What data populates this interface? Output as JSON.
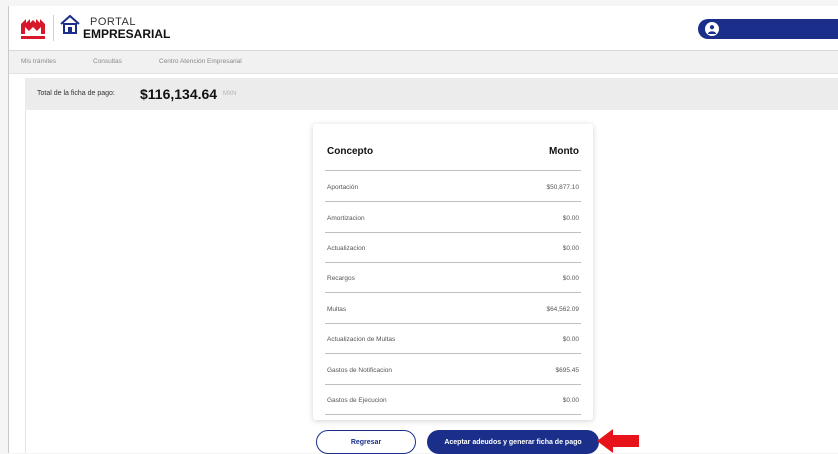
{
  "header": {
    "logo_small_text": "INFONAVIT",
    "brand_line1": "PORTAL",
    "brand_line2": "EMPRESARIAL"
  },
  "nav": {
    "items": [
      {
        "label": "Mis trámites"
      },
      {
        "label": "Consultas"
      },
      {
        "label": "Centro Atención Empresarial"
      }
    ]
  },
  "total": {
    "label": "Total de la ficha de pago:",
    "value": "$116,134.64",
    "currency": "MXN"
  },
  "table": {
    "headers": {
      "concept": "Concepto",
      "amount": "Monto"
    },
    "rows": [
      {
        "concept": "Aportación",
        "amount": "$50,877.10"
      },
      {
        "concept": "Amortizacion",
        "amount": "$0.00"
      },
      {
        "concept": "Actualizacion",
        "amount": "$0.00"
      },
      {
        "concept": "Recargos",
        "amount": "$0.00"
      },
      {
        "concept": "Multas",
        "amount": "$64,562.09"
      },
      {
        "concept": "Actualizacion de Multas",
        "amount": "$0.00"
      },
      {
        "concept": "Gastos de Notificacion",
        "amount": "$695.45"
      },
      {
        "concept": "Gastos de Ejecucion",
        "amount": "$0.00"
      }
    ]
  },
  "buttons": {
    "back": "Regresar",
    "accept": "Aceptar adeudos y generar ficha de pago"
  },
  "colors": {
    "primary": "#1b2f8a",
    "brand_red": "#d7182a",
    "arrow": "#e8121b"
  },
  "icons": {
    "user": "user-icon",
    "logo": "infonavit-logo",
    "house": "house-logo",
    "arrow": "red-arrow-annotation"
  }
}
